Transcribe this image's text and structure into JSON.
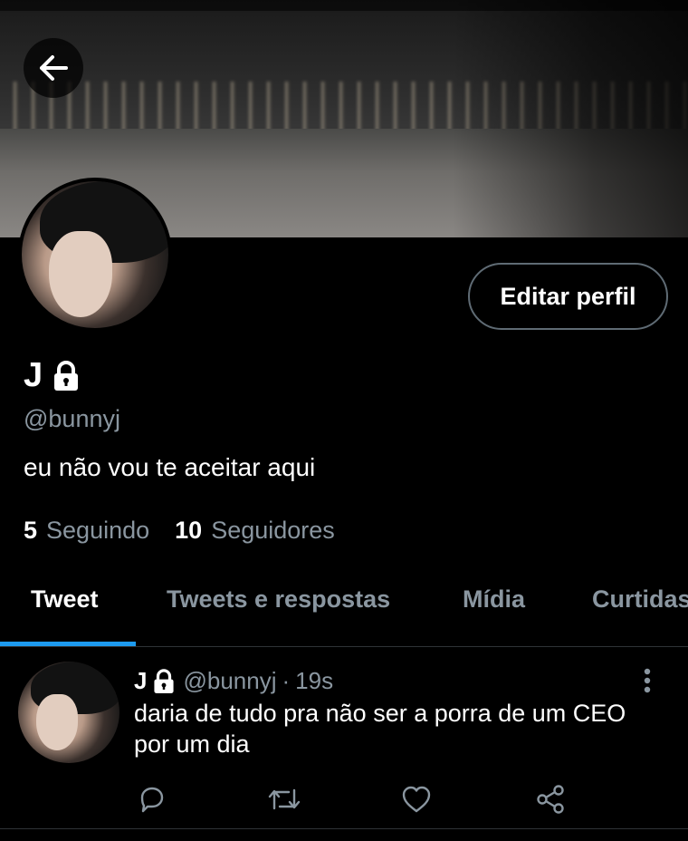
{
  "profile": {
    "name": "J",
    "handle": "@bunnyj",
    "bio": "eu não vou te aceitar aqui",
    "edit_label": "Editar perfil",
    "following_count": "5",
    "following_label": "Seguindo",
    "followers_count": "10",
    "followers_label": "Seguidores"
  },
  "tabs": [
    {
      "label": "Tweet",
      "active": true
    },
    {
      "label": "Tweets e respostas",
      "active": false
    },
    {
      "label": "Mídia",
      "active": false
    },
    {
      "label": "Curtidas",
      "active": false
    }
  ],
  "tweet": {
    "name": "J",
    "handle": "@bunnyj",
    "separator": "·",
    "time": "19s",
    "text": "daria de tudo pra não ser a porra de um CEO por um dia"
  },
  "colors": {
    "accent": "#1d9bf0",
    "muted": "#8a96a0",
    "background": "#000000"
  },
  "icons": {
    "back": "arrow-left-icon",
    "lock": "lock-icon",
    "more": "more-vertical-icon",
    "reply": "reply-icon",
    "retweet": "retweet-icon",
    "like": "heart-icon",
    "share": "share-icon"
  }
}
